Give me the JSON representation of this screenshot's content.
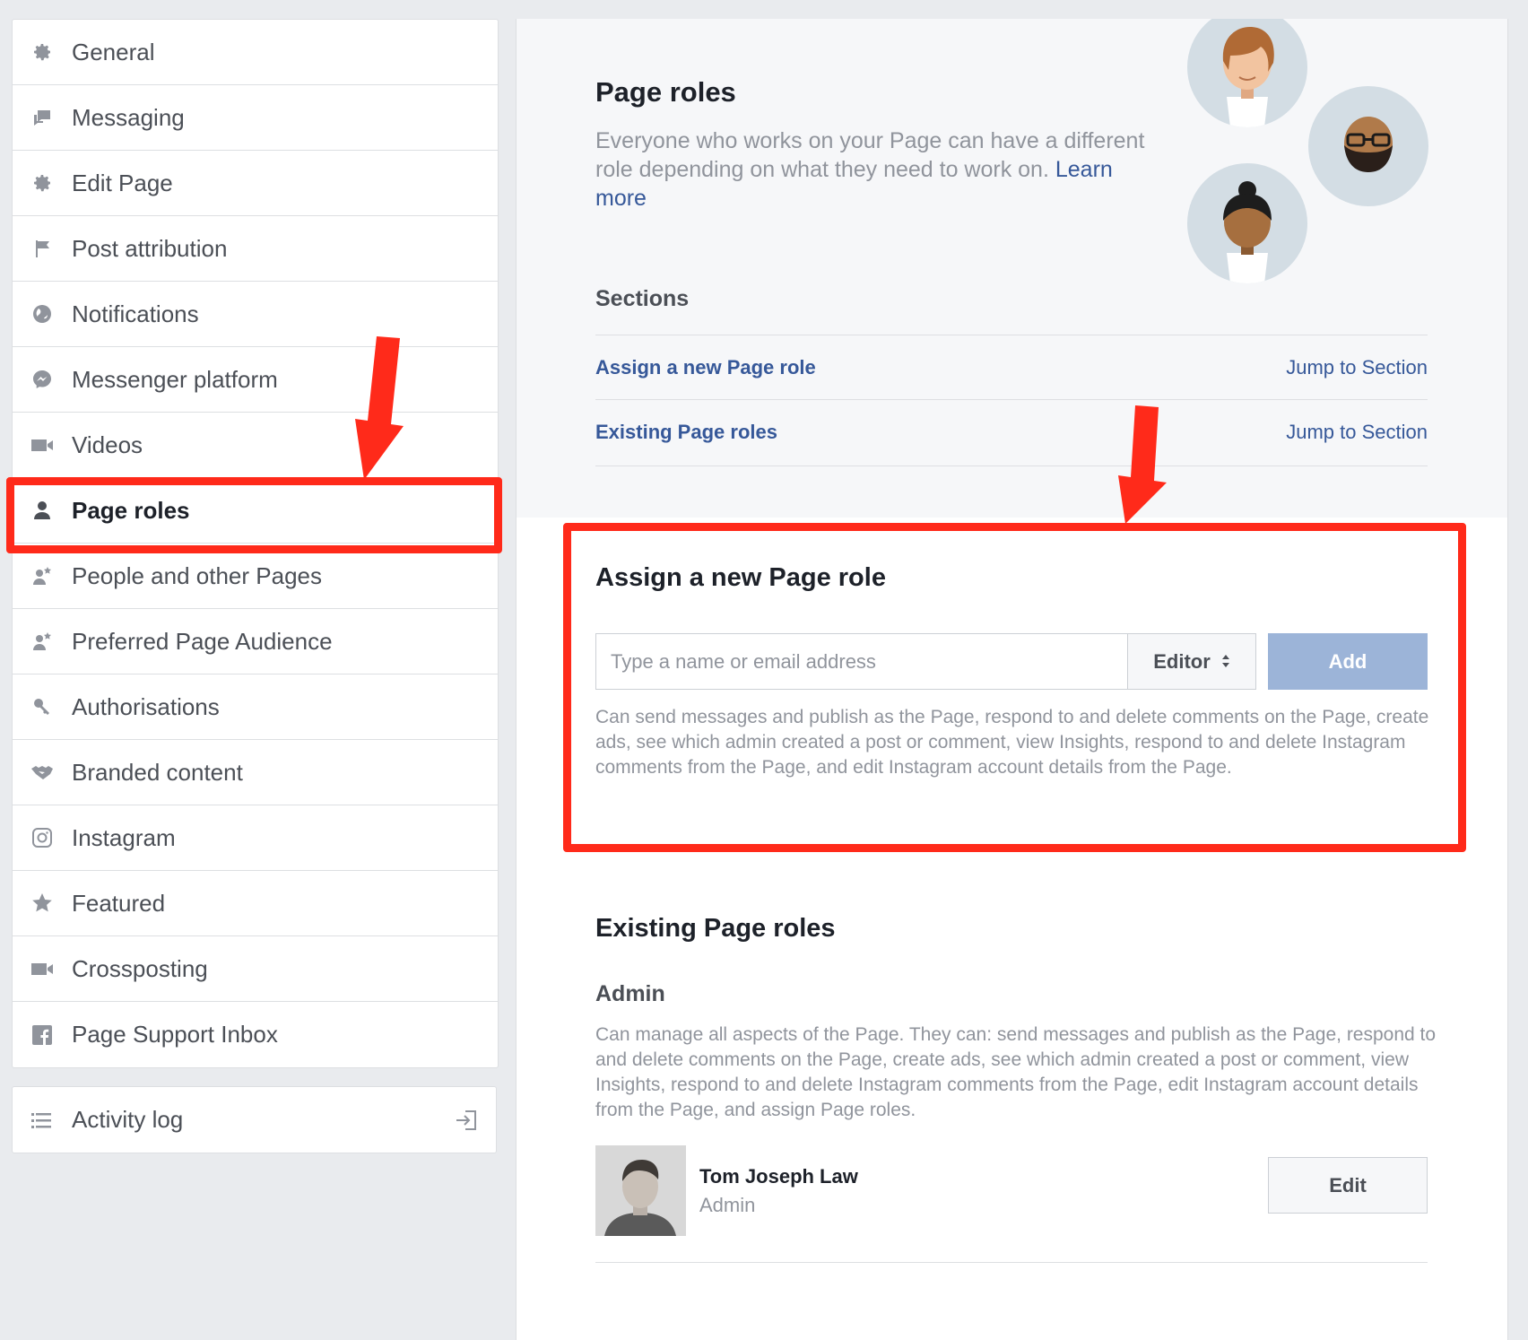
{
  "sidebar": {
    "items": [
      {
        "label": "General",
        "icon": "gear-icon"
      },
      {
        "label": "Messaging",
        "icon": "chat-bubbles-icon"
      },
      {
        "label": "Edit Page",
        "icon": "gear-icon"
      },
      {
        "label": "Post attribution",
        "icon": "flag-icon"
      },
      {
        "label": "Notifications",
        "icon": "globe-icon"
      },
      {
        "label": "Messenger platform",
        "icon": "messenger-icon"
      },
      {
        "label": "Videos",
        "icon": "video-camera-icon"
      },
      {
        "label": "Page roles",
        "icon": "person-icon"
      },
      {
        "label": "People and other Pages",
        "icon": "person-star-icon"
      },
      {
        "label": "Preferred Page Audience",
        "icon": "person-star-icon"
      },
      {
        "label": "Authorisations",
        "icon": "key-icon"
      },
      {
        "label": "Branded content",
        "icon": "handshake-icon"
      },
      {
        "label": "Instagram",
        "icon": "instagram-icon"
      },
      {
        "label": "Featured",
        "icon": "star-icon"
      },
      {
        "label": "Crossposting",
        "icon": "video-camera-icon"
      },
      {
        "label": "Page Support Inbox",
        "icon": "facebook-icon"
      }
    ],
    "active": "Page roles",
    "activity_log": {
      "label": "Activity log",
      "icon": "list-icon",
      "action_icon": "exit-arrow-icon"
    }
  },
  "main": {
    "title": "Page roles",
    "description": "Everyone who works on your Page can have a different role depending on what they need to work on.",
    "learn_more": "Learn more",
    "sections_title": "Sections",
    "sections": [
      {
        "name": "Assign a new Page role",
        "jump": "Jump to Section"
      },
      {
        "name": "Existing Page roles",
        "jump": "Jump to Section"
      }
    ],
    "assign": {
      "title": "Assign a new Page role",
      "placeholder": "Type a name or email address",
      "role": "Editor",
      "add_label": "Add",
      "description": "Can send messages and publish as the Page, respond to and delete comments on the Page, create ads, see which admin created a post or comment, view Insights, respond to and delete Instagram comments from the Page, and edit Instagram account details from the Page."
    },
    "existing": {
      "title": "Existing Page roles",
      "role_title": "Admin",
      "role_description": "Can manage all aspects of the Page. They can: send messages and publish as the Page, respond to and delete comments on the Page, create ads, see which admin created a post or comment, view Insights, respond to and delete Instagram comments from the Page, edit Instagram account details from the Page, and assign Page roles.",
      "user": {
        "name": "Tom Joseph Law",
        "role": "Admin"
      },
      "edit_label": "Edit"
    }
  },
  "colors": {
    "link": "#365899",
    "highlight": "#ff2a1a",
    "add_button": "#9cb4d8"
  }
}
